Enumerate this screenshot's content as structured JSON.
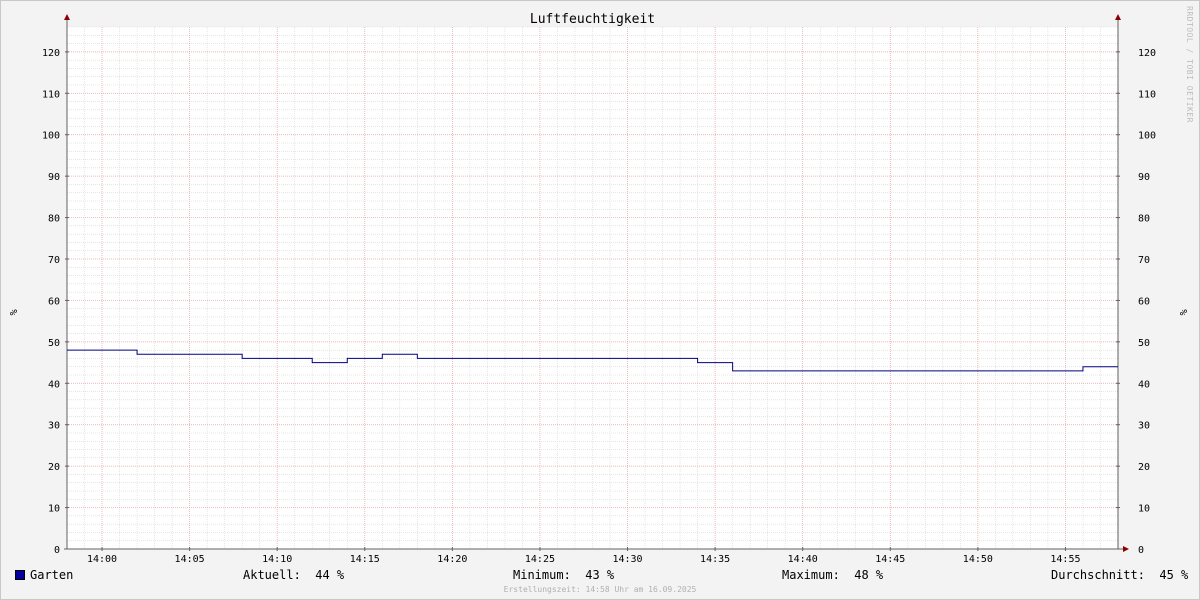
{
  "chart_data": {
    "type": "line",
    "title": "Luftfeuchtigkeit",
    "ylabel": "%",
    "ylabel_right": "%",
    "ylim": [
      0,
      126
    ],
    "yticks": [
      0,
      10,
      20,
      30,
      40,
      50,
      60,
      70,
      80,
      90,
      100,
      110,
      120
    ],
    "xlim": [
      "13:58",
      "14:58"
    ],
    "xticks": [
      "14:00",
      "14:05",
      "14:10",
      "14:15",
      "14:20",
      "14:25",
      "14:30",
      "14:35",
      "14:40",
      "14:45",
      "14:50",
      "14:55"
    ],
    "grid": true,
    "series": [
      {
        "name": "Garten",
        "color": "#000080",
        "step": true,
        "points": [
          [
            "13:58",
            48
          ],
          [
            "14:02",
            47
          ],
          [
            "14:08",
            46
          ],
          [
            "14:12",
            45
          ],
          [
            "14:14",
            46
          ],
          [
            "14:16",
            47
          ],
          [
            "14:18",
            46
          ],
          [
            "14:34",
            45
          ],
          [
            "14:36",
            43
          ],
          [
            "14:56",
            44
          ],
          [
            "14:58",
            44
          ]
        ]
      }
    ],
    "watermark": "RRDTOOL / TOBI OETIKER"
  },
  "legend": {
    "series_name": "Garten",
    "swatch_color": "#0000a0",
    "aktuell": "Aktuell:  44 %",
    "minimum": "Minimum:  43 %",
    "maximum": "Maximum:  48 %",
    "durchschnitt": "Durchschnitt:  45 %"
  },
  "footer": "Erstellungszeit: 14:58 Uhr am 16.09.2025"
}
